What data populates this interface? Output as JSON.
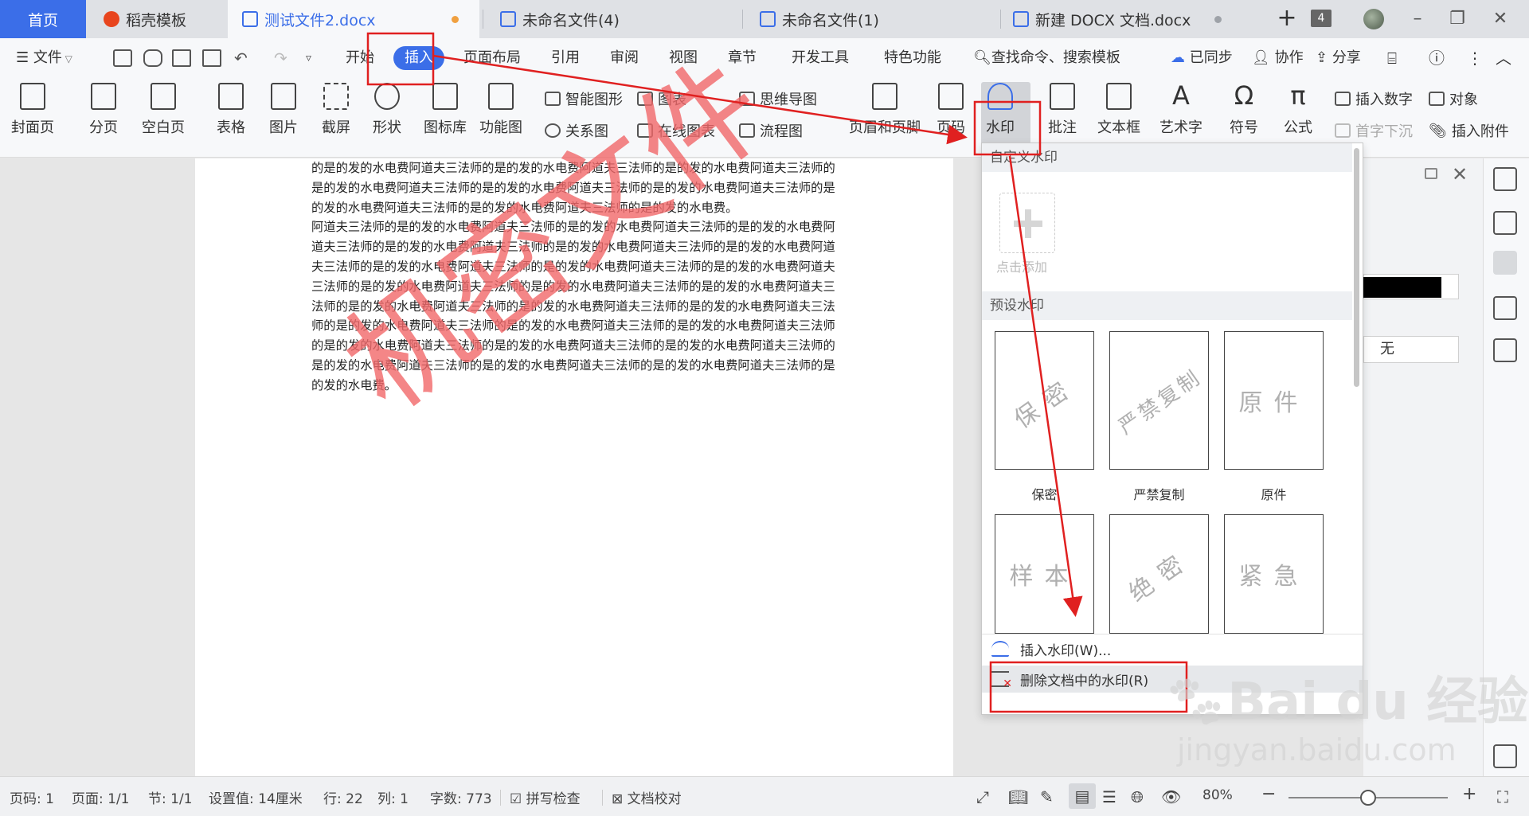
{
  "tabs": {
    "home": "首页",
    "template": "稻壳模板",
    "doc2": "测试文件2.docx",
    "unnamed4": "未命名文件(4)",
    "unnamed1": "未命名文件(1)",
    "newdocx": "新建 DOCX 文档.docx",
    "window_count": "4"
  },
  "menu": {
    "file": "文件",
    "start": "开始",
    "insert": "插入",
    "page_layout": "页面布局",
    "reference": "引用",
    "review": "审阅",
    "view": "视图",
    "chapter": "章节",
    "developer": "开发工具",
    "special": "特色功能",
    "search": "查找命令、搜索模板",
    "sync": "已同步",
    "collab": "协作",
    "share": "分享"
  },
  "ribbon": {
    "cover": "封面页",
    "page_break": "分页",
    "blank_page": "空白页",
    "table": "表格",
    "picture": "图片",
    "screenshot": "截屏",
    "shape": "形状",
    "icon_lib": "图标库",
    "func_chart": "功能图",
    "smart_shape": "智能图形",
    "chart": "图表",
    "mind_map": "思维导图",
    "relation": "关系图",
    "online_chart": "在线图表",
    "flowchart": "流程图",
    "header_footer": "页眉和页脚",
    "page_number": "页码",
    "watermark": "水印",
    "comment": "批注",
    "textbox": "文本框",
    "wordart": "艺术字",
    "symbol": "符号",
    "formula": "公式",
    "insert_number": "插入数字",
    "object": "对象",
    "drop_cap": "首字下沉",
    "attachment": "插入附件"
  },
  "document": {
    "paragraph1": "的是的发的水电费阿道夫三法师的是的发的水电费阿道夫三法师的是的发的水电费阿道夫三法师的是的发的水电费阿道夫三法师的是的发的水电费阿道夫三法师的是的发的水电费阿道夫三法师的是的发的水电费阿道夫三法师的是的发的水电费阿道夫三法师的是的发的水电费。",
    "paragraph2": "阿道夫三法师的是的发的水电费阿道夫三法师的是的发的水电费阿道夫三法师的是的发的水电费阿道夫三法师的是的发的水电费阿道夫三法师的是的发的水电费阿道夫三法师的是的发的水电费阿道夫三法师的是的发的水电费阿道夫三法师的是的发的水电费阿道夫三法师的是的发的水电费阿道夫三法师的是的发的水电费阿道夫三法师的是的发的水电费阿道夫三法师的是的发的水电费阿道夫三法师的是的发的水电费阿道夫三法师的是的发的水电费阿道夫三法师的是的发的水电费阿道夫三法师的是的发的水电费阿道夫三法师的是的发的水电费阿道夫三法师的是的发的水电费阿道夫三法师的是的发的水电费阿道夫三法师的是的发的水电费阿道夫三法师的是的发的水电费阿道夫三法师的是的发的水电费阿道夫三法师的是的发的水电费阿道夫三法师的是的发的水电费阿道夫三法师的是的发的水电费。",
    "watermark_text": "机密文件"
  },
  "watermark_menu": {
    "custom_header": "自定义水印",
    "add_label": "点击添加",
    "preset_header": "预设水印",
    "presets": [
      {
        "image_text": "保密",
        "label": "保密"
      },
      {
        "image_text": "严禁复制",
        "label": "严禁复制"
      },
      {
        "image_text": "原件",
        "label": "原件"
      },
      {
        "image_text": "样本",
        "label": ""
      },
      {
        "image_text": "绝密",
        "label": ""
      },
      {
        "image_text": "紧急",
        "label": ""
      }
    ],
    "insert": "插入水印(W)...",
    "delete": "删除文档中的水印(R)"
  },
  "side_panel": {
    "none_option": "无"
  },
  "status": {
    "page_no": "页码: 1",
    "pages": "页面: 1/1",
    "section": "节: 1/1",
    "setting": "设置值: 14厘米",
    "row": "行: 22",
    "col": "列: 1",
    "word_count": "字数: 773",
    "spell_check": "拼写检查",
    "proofread": "文档校对",
    "zoom": "80%",
    "zoom_level": 0.5
  },
  "logo": {
    "brand": "Baidu经验",
    "url": "jingyan.baidu.com"
  },
  "colors": {
    "accent": "#3b6ee8",
    "annotation": "#e02020",
    "watermark": "#f2686a"
  }
}
